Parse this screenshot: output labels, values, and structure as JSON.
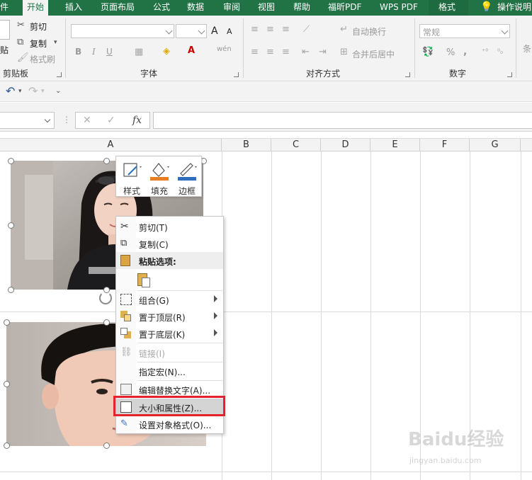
{
  "ribbon": {
    "tabs": [
      {
        "label": "件",
        "active": false
      },
      {
        "label": "开始",
        "active": true
      },
      {
        "label": "插入",
        "active": false
      },
      {
        "label": "页面布局",
        "active": false
      },
      {
        "label": "公式",
        "active": false
      },
      {
        "label": "数据",
        "active": false
      },
      {
        "label": "审阅",
        "active": false
      },
      {
        "label": "视图",
        "active": false
      },
      {
        "label": "帮助",
        "active": false
      },
      {
        "label": "福昕PDF",
        "active": false
      },
      {
        "label": "WPS PDF",
        "active": false
      },
      {
        "label": "格式",
        "active": false
      },
      {
        "label": "操作说明",
        "active": false
      }
    ],
    "clipboard": {
      "paste_label": "贴",
      "cut_label": "剪切",
      "copy_label": "复制",
      "format_painter_label": "格式刷",
      "group_label": "剪贴板"
    },
    "font": {
      "group_label": "字体",
      "bold": "B",
      "italic": "I",
      "underline": "U",
      "grow": "A",
      "shrink": "A",
      "phonetic": "wén"
    },
    "alignment": {
      "group_label": "对齐方式",
      "wrap_text": "自动换行",
      "merge_center": "合并后居中"
    },
    "number": {
      "group_label": "数字",
      "format_value": "常规",
      "percent": "%",
      "comma": ","
    },
    "condition_partial": "条"
  },
  "formula_bar": {
    "cancel": "✕",
    "enter": "✓",
    "fx": "fx"
  },
  "grid": {
    "columns": [
      "A",
      "B",
      "C",
      "D",
      "E",
      "F",
      "G"
    ]
  },
  "mini_toolbar": {
    "style": "样式",
    "fill": "填充",
    "outline": "边框"
  },
  "context_menu": {
    "items": [
      {
        "label": "剪切(T)",
        "icon": "scissors-icon",
        "submenu": false,
        "enabled": true
      },
      {
        "label": "复制(C)",
        "icon": "copy-icon",
        "submenu": false,
        "enabled": true
      },
      {
        "label": "粘贴选项:",
        "icon": "paste-icon",
        "submenu": false,
        "enabled": true
      },
      {
        "label": "组合(G)",
        "icon": "group-icon",
        "submenu": true,
        "enabled": true
      },
      {
        "label": "置于顶层(R)",
        "icon": "bring-front-icon",
        "submenu": true,
        "enabled": true
      },
      {
        "label": "置于底层(K)",
        "icon": "send-back-icon",
        "submenu": true,
        "enabled": true
      },
      {
        "label": "链接(I)",
        "icon": "link-icon",
        "submenu": false,
        "enabled": false
      },
      {
        "label": "指定宏(N)...",
        "icon": "",
        "submenu": false,
        "enabled": true
      },
      {
        "label": "编辑替换文字(A)...",
        "icon": "alt-text-icon",
        "submenu": false,
        "enabled": true
      },
      {
        "label": "大小和属性(Z)...",
        "icon": "size-properties-icon",
        "submenu": false,
        "enabled": true,
        "hovered": true
      },
      {
        "label": "设置对象格式(O)...",
        "icon": "format-object-icon",
        "submenu": false,
        "enabled": true
      }
    ]
  },
  "watermark": {
    "brand": "Baidu经验",
    "url": "jingyan.baidu.com"
  },
  "colors": {
    "ribbon_green": "#217346",
    "highlight_red": "#e4232c",
    "fill_orange": "#e67e22",
    "outline_blue": "#2e6fbd"
  }
}
